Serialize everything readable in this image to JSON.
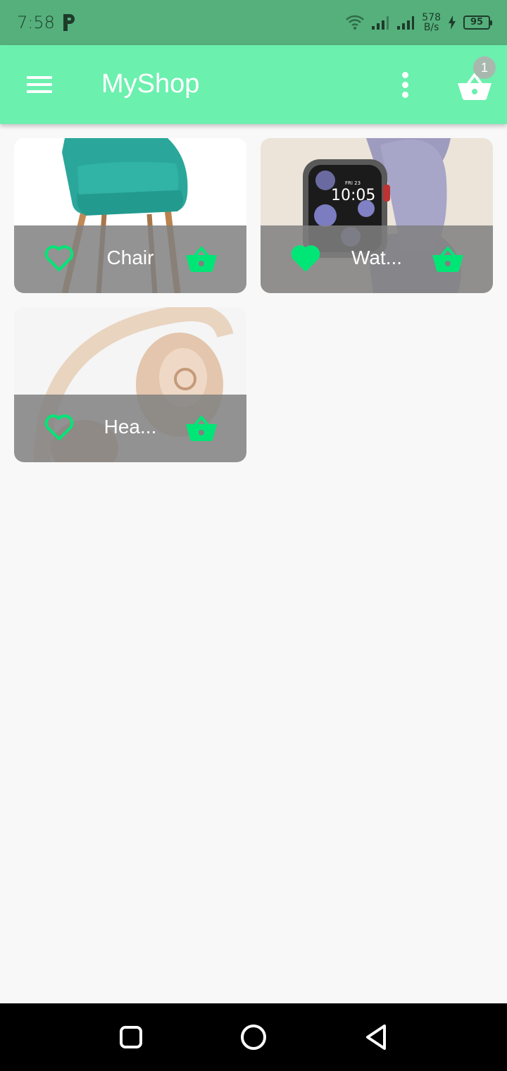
{
  "status_bar": {
    "time": "7:58",
    "speed_value": "578",
    "speed_unit": "B/s",
    "battery": "95"
  },
  "app_bar": {
    "title": "MyShop",
    "cart_count": "1"
  },
  "products": [
    {
      "name": "Chair",
      "favorite": false
    },
    {
      "name": "Wat...",
      "favorite": true
    },
    {
      "name": "Hea...",
      "favorite": false
    }
  ],
  "colors": {
    "accent": "#6bf0ae",
    "icon_green": "#00e676",
    "status_bar": "#55b07c"
  }
}
